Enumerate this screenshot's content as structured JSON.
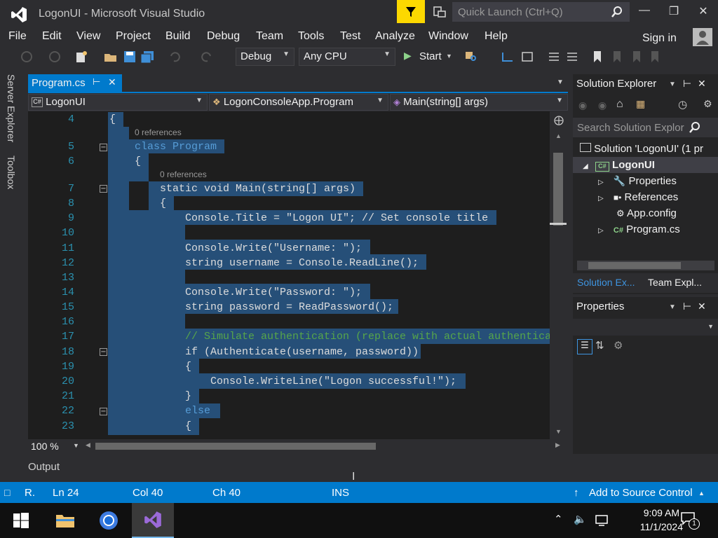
{
  "window": {
    "title": "LogonUI - Microsoft Visual Studio",
    "quick_launch_placeholder": "Quick Launch (Ctrl+Q)"
  },
  "menu": [
    "File",
    "Edit",
    "View",
    "Project",
    "Build",
    "Debug",
    "Team",
    "Tools",
    "Test",
    "Analyze",
    "Window",
    "Help"
  ],
  "account": {
    "signin": "Sign in"
  },
  "toolbar": {
    "config": "Debug",
    "platform": "Any CPU",
    "start": "Start"
  },
  "side_tabs": {
    "server_explorer": "Server Explorer",
    "toolbox": "Toolbox"
  },
  "document": {
    "tab": "Program.cs"
  },
  "navbar": {
    "project": "LogonUI",
    "class": "LogonConsoleApp.Program",
    "member": "Main(string[] args)"
  },
  "editor": {
    "references_label": "0 references",
    "lines": [
      {
        "n": "4",
        "text": "{"
      },
      {
        "n": "5",
        "text": "class Program"
      },
      {
        "n": "6",
        "text": "{"
      },
      {
        "n": "7",
        "text": "static void Main(string[] args)"
      },
      {
        "n": "8",
        "text": "{"
      },
      {
        "n": "9",
        "text": "Console.Title = \"Logon UI\"; // Set console title"
      },
      {
        "n": "10",
        "text": ""
      },
      {
        "n": "11",
        "text": "Console.Write(\"Username: \");"
      },
      {
        "n": "12",
        "text": "string username = Console.ReadLine();"
      },
      {
        "n": "13",
        "text": ""
      },
      {
        "n": "14",
        "text": "Console.Write(\"Password: \");"
      },
      {
        "n": "15",
        "text": "string password = ReadPassword();"
      },
      {
        "n": "16",
        "text": ""
      },
      {
        "n": "17",
        "text": "// Simulate authentication (replace with actual authentica"
      },
      {
        "n": "18",
        "text": "if (Authenticate(username, password))"
      },
      {
        "n": "19",
        "text": "{"
      },
      {
        "n": "20",
        "text": "Console.WriteLine(\"Logon successful!\");"
      },
      {
        "n": "21",
        "text": "}"
      },
      {
        "n": "22",
        "text": "else"
      },
      {
        "n": "23",
        "text": "{"
      }
    ],
    "zoom": "100 %"
  },
  "output_panel": {
    "label": "Output"
  },
  "solution_explorer": {
    "title": "Solution Explorer",
    "search_placeholder": "Search Solution Explor",
    "solution": "Solution 'LogonUI' (1 pr",
    "project": "LogonUI",
    "items": [
      "Properties",
      "References",
      "App.config",
      "Program.cs"
    ],
    "tabs": [
      "Solution Ex...",
      "Team Expl..."
    ]
  },
  "properties": {
    "title": "Properties"
  },
  "statusbar": {
    "state": "R.",
    "ln": "Ln 24",
    "col": "Col 40",
    "ch": "Ch 40",
    "mode": "INS",
    "source_control": "Add to Source Control"
  },
  "taskbar": {
    "time": "9:09 AM",
    "date": "11/1/2024",
    "notifications": "1"
  },
  "colors": {
    "accent": "#007acc",
    "filter": "#fcd800",
    "selection": "#264f78"
  }
}
